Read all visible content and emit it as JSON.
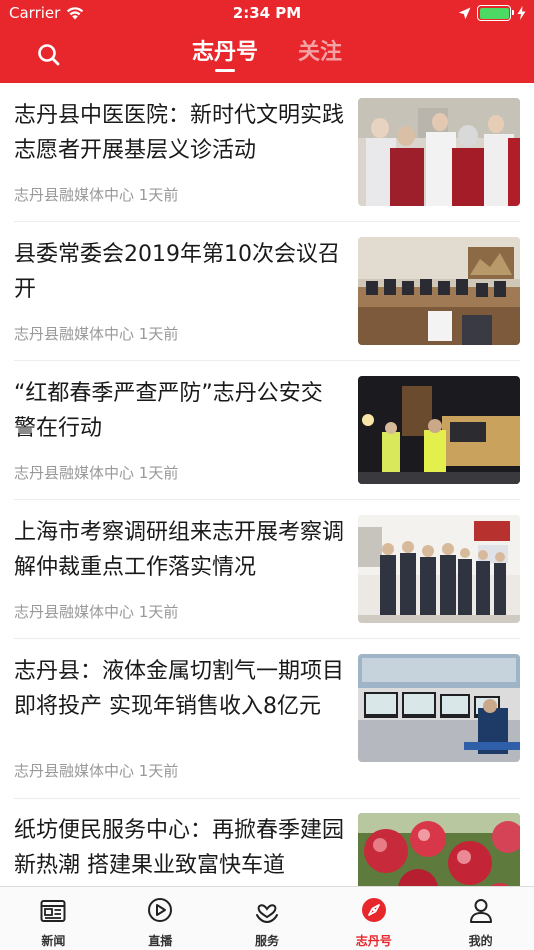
{
  "status_bar": {
    "carrier": "Carrier",
    "time": "2:34 PM"
  },
  "nav": {
    "tabs": [
      {
        "label": "志丹号",
        "active": true
      },
      {
        "label": "关注",
        "active": false
      }
    ]
  },
  "articles": [
    {
      "title": "志丹县中医医院：新时代文明实践志愿者开展基层义诊活动",
      "source": "志丹县融媒体中心",
      "time": "1天前",
      "image": "medical-volunteers-photo"
    },
    {
      "title": "县委常委会2019年第10次会议召开",
      "source": "志丹县融媒体中心",
      "time": "1天前",
      "image": "meeting-room-photo"
    },
    {
      "title": "“红都春季严查严防”志丹公安交警在行动",
      "source": "志丹县融媒体中心",
      "time": "1天前",
      "image": "traffic-police-night-photo"
    },
    {
      "title": "上海市考察调研组来志开展考察调解仲裁重点工作落实情况",
      "source": "志丹县融媒体中心",
      "time": "1天前",
      "image": "inspection-group-photo"
    },
    {
      "title": "志丹县：液体金属切割气一期项目即将投产 实现年销售收入8亿元",
      "source": "志丹县融媒体中心",
      "time": "1天前",
      "image": "control-room-photo"
    },
    {
      "title": "纸坊便民服务中心：再掀春季建园新热潮 搭建果业致富快车道",
      "source": "",
      "time": "",
      "image": "apples-photo"
    }
  ],
  "tabbar": [
    {
      "label": "新闻",
      "icon": "news-icon",
      "active": false
    },
    {
      "label": "直播",
      "icon": "live-play-icon",
      "active": false
    },
    {
      "label": "服务",
      "icon": "service-icon",
      "active": false
    },
    {
      "label": "志丹号",
      "icon": "compass-icon",
      "active": true
    },
    {
      "label": "我的",
      "icon": "profile-icon",
      "active": false
    }
  ],
  "colors": {
    "brand_red": "#e8272d",
    "meta_gray": "#999999",
    "battery_green": "#4cd964"
  }
}
